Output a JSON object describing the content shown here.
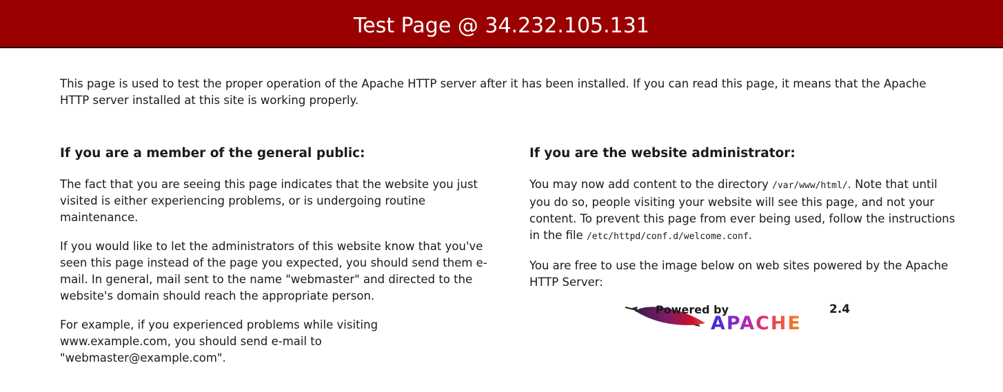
{
  "header": {
    "title": "Test Page @ 34.232.105.131"
  },
  "intro": {
    "text": "This page is used to test the proper operation of the Apache HTTP server after it has been installed. If you can read this page, it means that the Apache HTTP server installed at this site is working properly."
  },
  "public": {
    "heading": "If you are a member of the general public:",
    "p1": "The fact that you are seeing this page indicates that the website you just visited is either experiencing problems, or is undergoing routine maintenance.",
    "p2": "If you would like to let the administrators of this website know that you've seen this page instead of the page you expected, you should send them e-mail. In general, mail sent to the name \"webmaster\" and directed to the website's domain should reach the appropriate person.",
    "p3": "For example, if you experienced problems while visiting www.example.com, you should send e-mail to \"webmaster@example.com\"."
  },
  "admin": {
    "heading": "If you are the website administrator:",
    "p1_a": "You may now add content to the directory ",
    "p1_path": "/var/www/html/",
    "p1_b": ". Note that until you do so, people visiting your website will see this page, and not your content. To prevent this page from ever being used, follow the instructions in the file ",
    "p1_file": "/etc/httpd/conf.d/welcome.conf",
    "p1_c": ".",
    "p2": "You are free to use the image below on web sites powered by the Apache HTTP Server:"
  },
  "badge": {
    "powered_by": "Powered by",
    "version": "2.4",
    "brand": "APACHE",
    "colors": {
      "feather_red": "#c8102e",
      "feather_purple": "#5a1b6e",
      "apache_blue": "#3b2bd8",
      "apache_orange": "#f28a1c"
    }
  },
  "theme": {
    "header_bg": "#9b0000"
  }
}
